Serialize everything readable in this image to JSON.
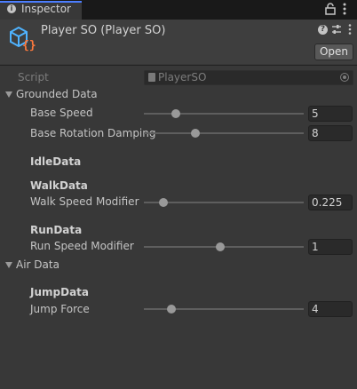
{
  "tab": {
    "label": "Inspector"
  },
  "header": {
    "title": "Player SO (Player SO)",
    "open_label": "Open"
  },
  "script_field": {
    "label": "Script",
    "value": "PlayerSO"
  },
  "grounded": {
    "label": "Grounded Data",
    "base_speed": {
      "label": "Base Speed",
      "value": "5",
      "slider_fraction": 0.2
    },
    "base_rotation_damping": {
      "label": "Base Rotation Damping",
      "value": "8",
      "slider_fraction": 0.32
    },
    "idle": {
      "label": "IdleData"
    },
    "walk": {
      "label": "WalkData",
      "modifier": {
        "label": "Walk Speed Modifier",
        "value": "0.225",
        "slider_fraction": 0.12
      }
    },
    "run": {
      "label": "RunData",
      "modifier": {
        "label": "Run Speed Modifier",
        "value": "1",
        "slider_fraction": 0.48
      }
    }
  },
  "air": {
    "label": "Air Data",
    "jump": {
      "label": "JumpData",
      "force": {
        "label": "Jump Force",
        "value": "4",
        "slider_fraction": 0.17
      }
    }
  }
}
